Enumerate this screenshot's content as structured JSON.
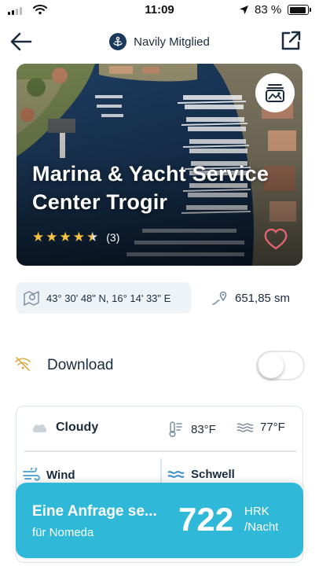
{
  "status_bar": {
    "time": "11:09",
    "battery_text": "83 %",
    "battery_level": 0.83,
    "signal_bars_filled": 2,
    "signal_bars_total": 4
  },
  "header": {
    "member_label": "Navily Mitglied",
    "icons": {
      "back": "arrow-left-icon",
      "member": "anchor-icon",
      "share": "external-link-icon"
    }
  },
  "marina": {
    "name": "Marina & Yacht Service Center Trogir",
    "rating": 4.5,
    "rating_max": 5,
    "review_count_text": "(3)",
    "favorite_color": "#e4636f",
    "icons": {
      "gallery": "photo-gallery-icon",
      "favorite": "heart-icon"
    }
  },
  "info": {
    "coordinates": "43° 30' 48\" N, 16° 14' 33\" E",
    "distance": "651,85 sm",
    "icons": {
      "coordinates": "map-pin-icon",
      "distance": "route-icon"
    }
  },
  "download": {
    "label": "Download",
    "enabled": false,
    "icons": {
      "status": "wifi-off-icon"
    }
  },
  "weather": {
    "condition": "Cloudy",
    "air_temp": "83°F",
    "water_temp": "77°F",
    "wind_label": "Wind",
    "swell_label": "Schwell",
    "icons": {
      "condition": "cloud-icon",
      "air": "thermometer-icon",
      "water": "water-waves-icon",
      "wind": "wind-icon",
      "swell": "swell-icon"
    }
  },
  "booking": {
    "title": "Eine Anfrage se...",
    "subtitle": "für Nomeda",
    "price": "722",
    "currency": "HRK",
    "unit": "/Nacht",
    "color": "#2fb8d8"
  },
  "colors": {
    "primary_text": "#1b2b3d",
    "accent": "#2fb8d8",
    "chip_bg": "#eef3f7",
    "star": "#f6c343"
  }
}
